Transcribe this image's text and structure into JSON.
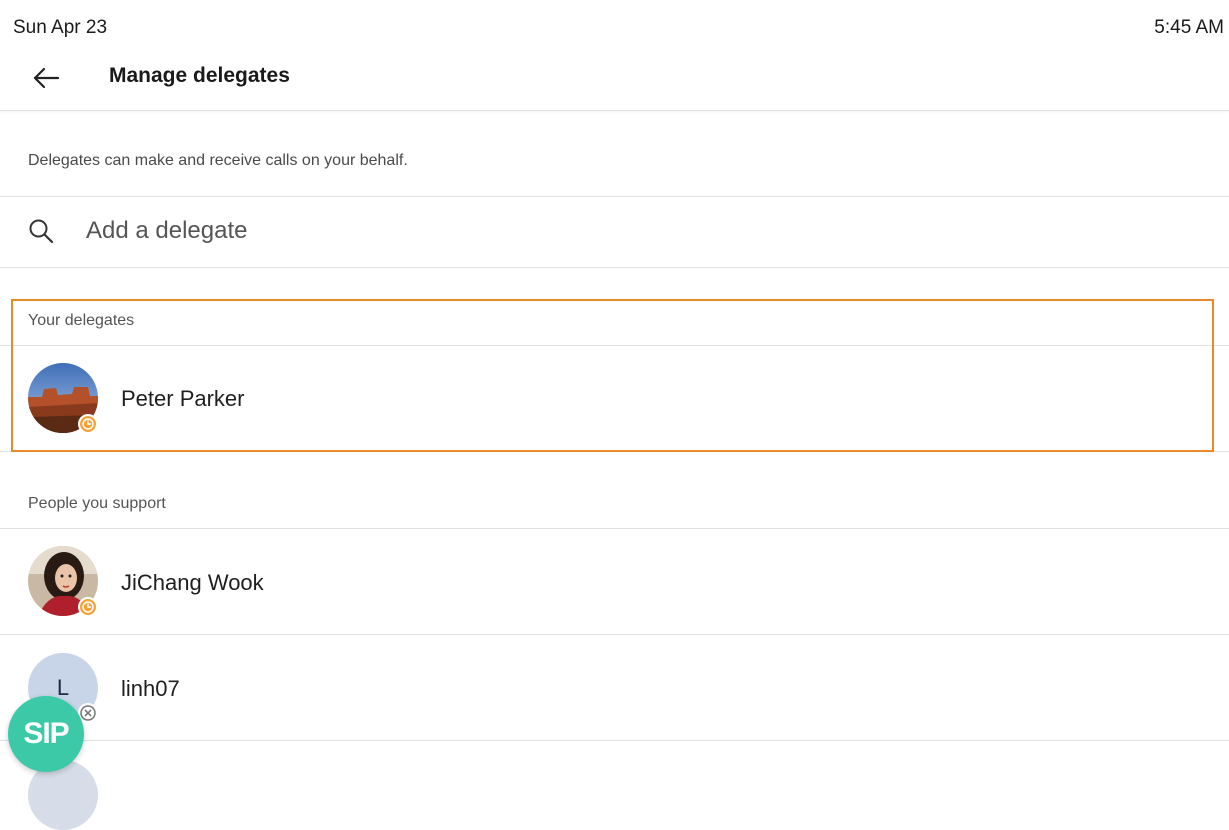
{
  "status_bar": {
    "date": "Sun Apr 23",
    "time": "5:45 AM"
  },
  "header": {
    "title": "Manage delegates",
    "back_icon": "arrow-left-icon"
  },
  "description": "Delegates can make and receive calls on your behalf.",
  "search": {
    "placeholder": "Add a delegate",
    "value": "",
    "icon": "search-icon"
  },
  "your_delegates": {
    "header": "Your delegates",
    "items": [
      {
        "name": "Peter Parker",
        "avatar": "photo",
        "presence": "away"
      }
    ]
  },
  "people_you_support": {
    "header": "People you support",
    "items": [
      {
        "name": "JiChang Wook",
        "avatar": "photo",
        "presence": "away"
      },
      {
        "name": "linh07",
        "avatar_initial": "L",
        "presence": "offline"
      }
    ]
  },
  "sip_badge": {
    "label": "SIP",
    "color": "#3bc9a8"
  },
  "colors": {
    "highlight": "#e8892a",
    "away": "#f2a33a",
    "initial_avatar_bg": "#c8d4e8"
  }
}
